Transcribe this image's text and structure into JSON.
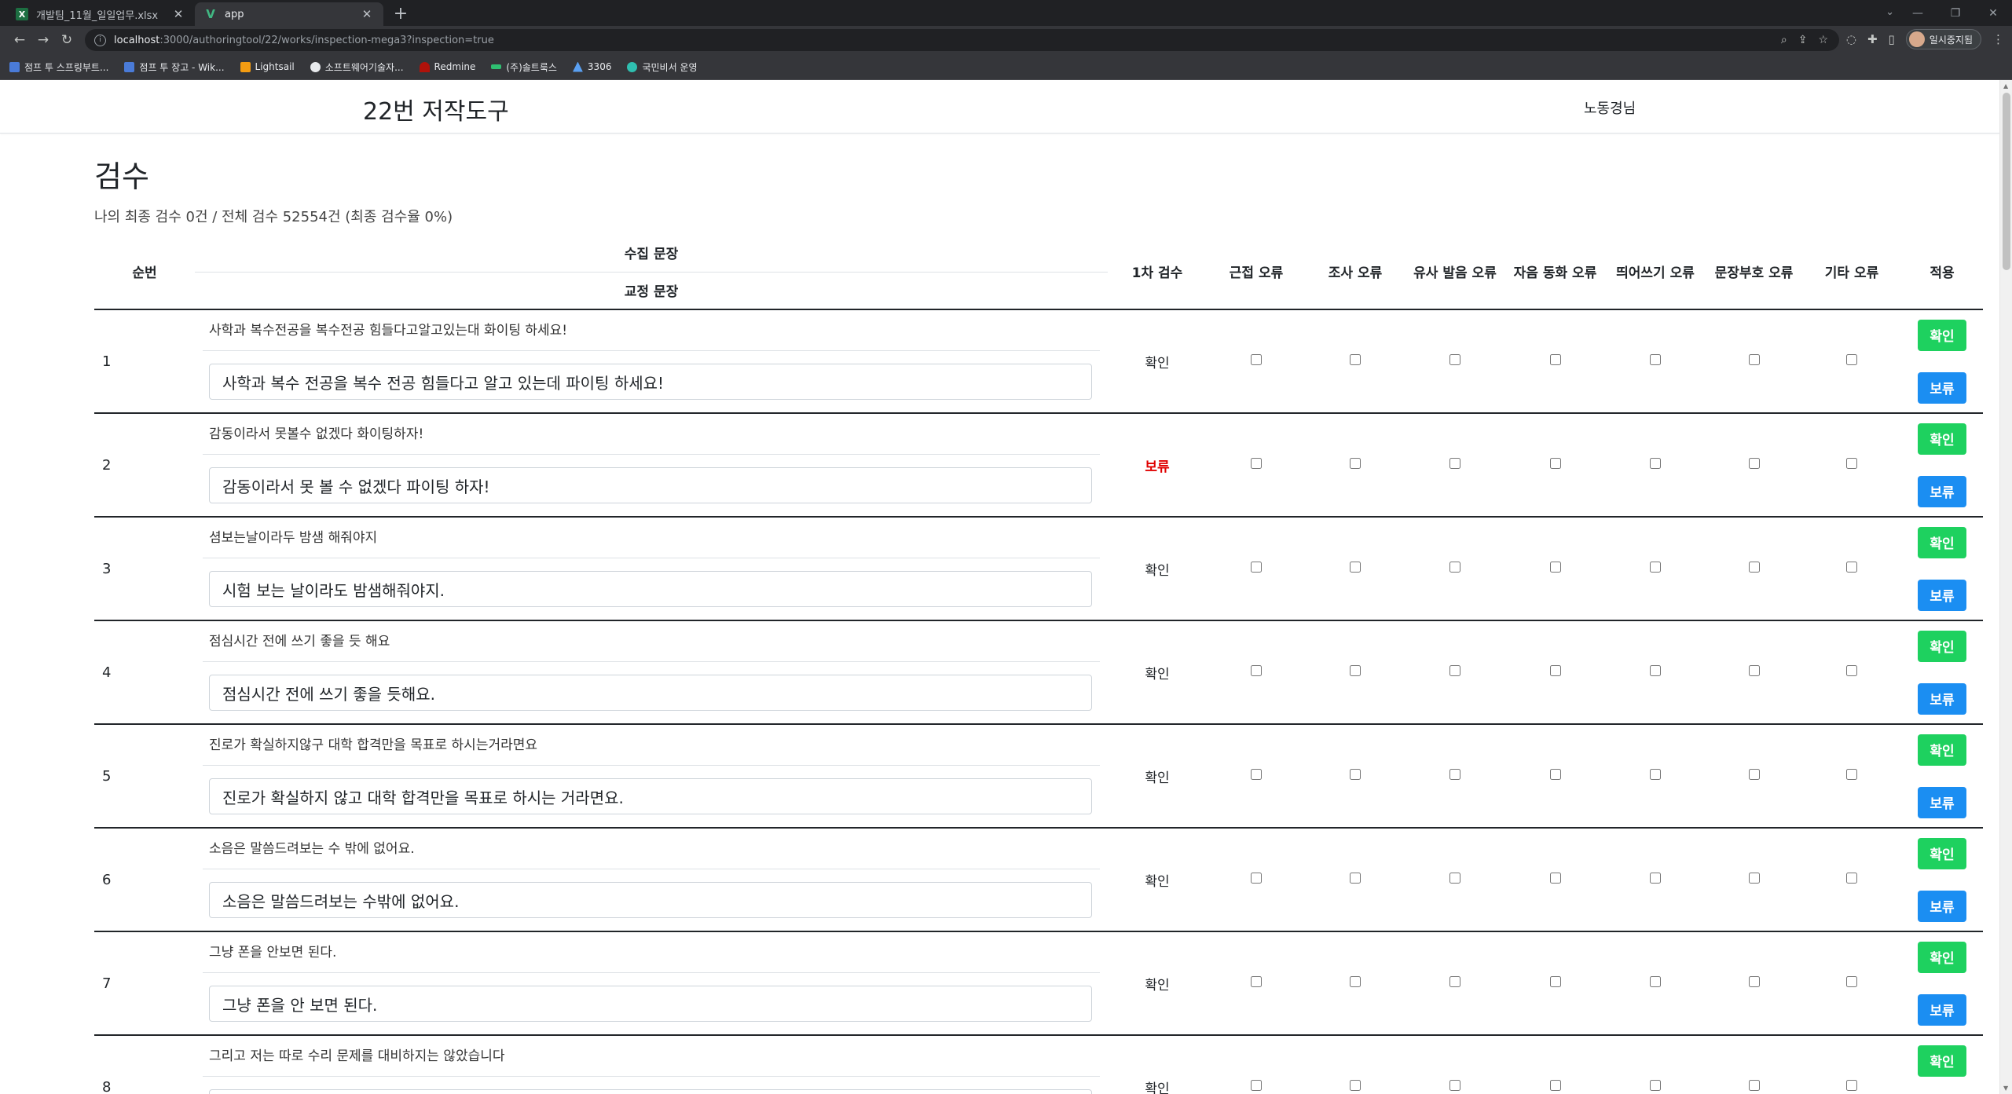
{
  "browser": {
    "tabs": [
      {
        "label": "개발팀_11월_일일업무.xlsx",
        "icon": "excel-icon",
        "active": false
      },
      {
        "label": "app",
        "icon": "vue-icon",
        "active": true
      }
    ],
    "url_host": "localhost",
    "url_path": ":3000/authoringtool/22/works/inspection-mega3?inspection=true",
    "profile_label": "일시중지됨",
    "bookmarks": [
      {
        "label": "점프 투 스프링부트...",
        "color": "#4a7bd8"
      },
      {
        "label": "점프 투 장고 - Wik...",
        "color": "#4a7bd8"
      },
      {
        "label": "Lightsail",
        "color": "#f39c12"
      },
      {
        "label": "소프트웨어기술자...",
        "color": "#e8eaed"
      },
      {
        "label": "Redmine",
        "color": "#b0120a"
      },
      {
        "label": "(주)솔트룩스",
        "color": "#2fbf71"
      },
      {
        "label": "3306",
        "color": "#5aa0f2"
      },
      {
        "label": "국민비서 운영",
        "color": "#2fbfb0"
      }
    ]
  },
  "app": {
    "brand": "22번 저작도구",
    "user": "노동경님"
  },
  "page": {
    "title": "검수",
    "summary": "나의 최종 검수 0건 / 전체 검수 52554건 (최종 검수율 0%)"
  },
  "table": {
    "headers": {
      "num": "순번",
      "collected": "수집 문장",
      "corrected": "교정 문장",
      "first_check": "1차 검수",
      "err1": "근접 오류",
      "err2": "조사 오류",
      "err3": "유사 발음 오류",
      "err4": "자음 동화 오류",
      "err5": "띄어쓰기 오류",
      "err6": "문장부호 오류",
      "err7": "기타 오류",
      "apply": "적용"
    },
    "btn_ok": "확인",
    "btn_hold": "보류",
    "rows": [
      {
        "num": "1",
        "orig": "사학과 복수전공을 복수전공 힘들다고알고있는대 화이팅 하세요!",
        "corr": "사학과 복수 전공을 복수 전공 힘들다고 알고 있는데 파이팅 하세요!",
        "status": "확인"
      },
      {
        "num": "2",
        "orig": "감동이라서 못볼수 없겠다 화이팅하자!",
        "corr": "감동이라서 못 볼 수 없겠다 파이팅 하자!",
        "status": "보류"
      },
      {
        "num": "3",
        "orig": "셤보는날이라두 밤샘 해줘야지",
        "corr": "시험 보는 날이라도 밤샘해줘야지.",
        "status": "확인"
      },
      {
        "num": "4",
        "orig": "점심시간 전에 쓰기 좋을 듯 해요",
        "corr": "점심시간 전에 쓰기 좋을 듯해요.",
        "status": "확인"
      },
      {
        "num": "5",
        "orig": "진로가 확실하지않구 대학 합격만을 목표로 하시는거라면요",
        "corr": "진로가 확실하지 않고 대학 합격만을 목표로 하시는 거라면요.",
        "status": "확인"
      },
      {
        "num": "6",
        "orig": "소음은 말씀드려보는 수 밖에 없어요.",
        "corr": "소음은 말씀드려보는 수밖에 없어요.",
        "status": "확인"
      },
      {
        "num": "7",
        "orig": "그냥 폰을 안보면 된다.",
        "corr": "그냥 폰을 안 보면 된다.",
        "status": "확인"
      },
      {
        "num": "8",
        "orig": "그리고 저는 따로 수리 문제를 대비하지는 않았습니다",
        "corr": "",
        "status": "확인"
      }
    ]
  }
}
